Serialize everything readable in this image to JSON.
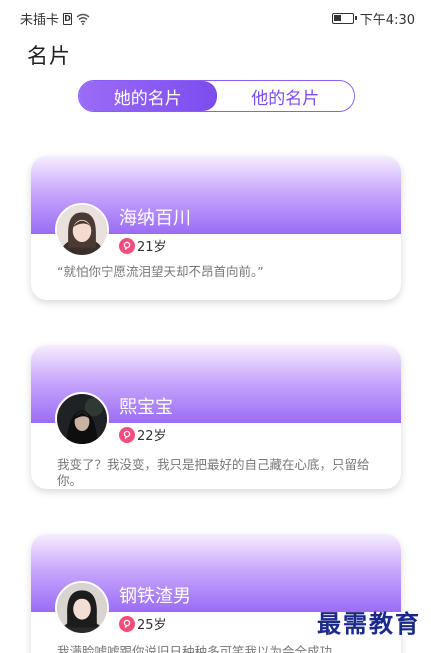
{
  "status_bar": {
    "carrier": "未插卡",
    "sim_glyph": "D",
    "time": "下午4:30"
  },
  "page_title": "名片",
  "tabs": [
    {
      "label": "她的名片",
      "active": true
    },
    {
      "label": "他的名片",
      "active": false
    }
  ],
  "cards": [
    {
      "name": "海纳百川",
      "age": "21岁",
      "quote": "“就怕你宁愿流泪望天却不昂首向前。”"
    },
    {
      "name": "熙宝宝",
      "age": "22岁",
      "quote": "我变了？我没变，我只是把最好的自己藏在心底，只留给你。"
    },
    {
      "name": "钢铁渣男",
      "age": "25岁",
      "quote": "我满脸嘘嘘跟你说旧日种种多可笑我以为会全成功"
    }
  ],
  "watermark": "最需教育",
  "colors": {
    "accent": "#8b5cf6",
    "age_badge": "#f24d7c",
    "watermark": "#1b2a8a"
  }
}
